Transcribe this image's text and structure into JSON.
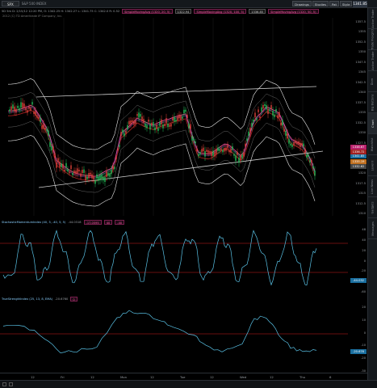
{
  "toolbar": {
    "symbol": "SPX",
    "desc": "S&P 500 INDEX",
    "buttons": [
      "Drawings",
      "Studies",
      "Pat",
      "Style",
      "Styles"
    ]
  },
  "last_price": "1341.85",
  "info": {
    "ohlc": "5D 5m  D: 2/15/12 12:20 PM,  O: 1342.25  H: 1342.27  L: 1341.75  C: 1342.0  R: 0.52",
    "tags": [
      "SimpleMovingAvg (1320, 20, 5)",
      "1322.94",
      "SimpleMovingAvg (1320, 100, 5)",
      "1336.85",
      "SimpleMovingAvg (1320, 50, 5)",
      "1341.67"
    ],
    "copyright": "2012 (C) TD Ameritrade IP Company, Inc."
  },
  "stoch": {
    "title": "StochasticMomentumIndex (40, 3, -40, 5, 5)",
    "value": "-44.0318",
    "tags": [
      "-17.0595",
      "40",
      "-40"
    ],
    "axis": [
      "48",
      "40",
      "20",
      "0",
      "-20",
      "-40",
      "-60"
    ],
    "badge": "-44.032"
  },
  "tsi": {
    "title": "TrueStrengthIndex (25, 13, 8, EMA)",
    "value": "-20.6760",
    "tags": [
      "0"
    ],
    "axis": [
      "20",
      "10",
      "0",
      "-10",
      "-20",
      "-30"
    ],
    "badge": "-20.676"
  },
  "price_axis": [
    "1357.5",
    "1355",
    "1352.5",
    "1350",
    "1347.5",
    "1345",
    "1342.5",
    "1340",
    "1337.5",
    "1335",
    "1332.5",
    "1330",
    "1327.5",
    "1325",
    "1322.5",
    "1320",
    "1317.5",
    "1315",
    "1312.5",
    "1310"
  ],
  "price_badges": [
    "1341.85",
    "1338.67",
    "1336.72",
    "1335.19",
    "1332.62"
  ],
  "x_axis": [
    "12",
    "Fri",
    "12",
    "Mon",
    "12",
    "Tue",
    "12",
    "Wed",
    "12",
    "Thu",
    "6"
  ],
  "right_tabs": [
    "Active Trader",
    "Trade Flexgrid",
    "Active Trader",
    "Dom",
    "Big Buttons",
    "Chart",
    "Watchlist",
    "Level II",
    "Live News",
    "Gadgets",
    "Messages"
  ],
  "colors": {
    "up": "#22c05a",
    "down": "#e0433a",
    "ma1": "#ff55aa",
    "ma2": "#b22222",
    "band": "#e6e6e6",
    "osc": "#59c2e6",
    "ref": "#d01d1d"
  }
}
